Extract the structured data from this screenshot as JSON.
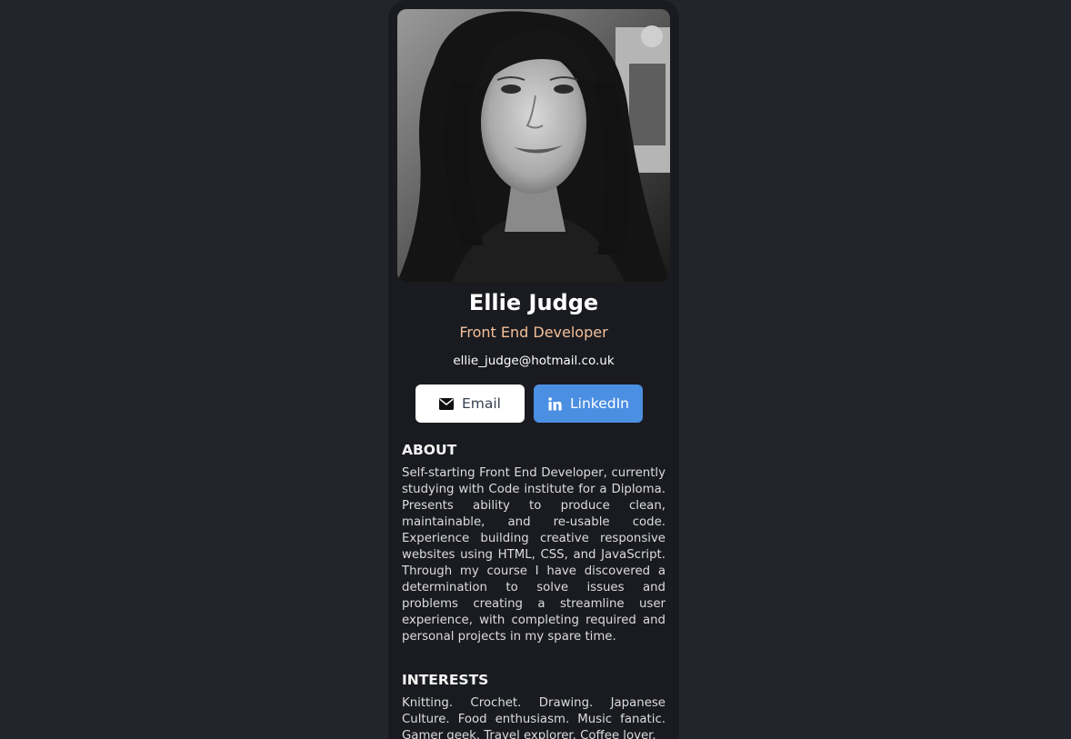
{
  "profile": {
    "name": "Ellie Judge",
    "role": "Front End Developer",
    "email": "ellie_judge@hotmail.co.uk",
    "photo_icon": "portrait-photo"
  },
  "buttons": {
    "email_label": "Email",
    "email_icon": "envelope-icon",
    "linkedin_label": "LinkedIn",
    "linkedin_icon": "linkedin-icon"
  },
  "about": {
    "title": "ABOUT",
    "text": "Self-starting Front End Developer, currently studying with Code institute for a Diploma. Presents ability to produce clean, maintainable, and re-usable code. Experience building creative responsive websites using HTML, CSS, and JavaScript. Through my course I have discovered a determination to solve issues and problems creating a streamline user experience, with completing required and personal projects in my spare time."
  },
  "interests": {
    "title": "INTERESTS",
    "text": "Knitting. Crochet. Drawing. Japanese Culture. Food enthusiasm. Music fanatic. Gamer geek. Travel explorer. Coffee lover."
  },
  "colors": {
    "page_background": "#23252c",
    "card_background": "#1a1b20",
    "role_accent": "#f3bf99",
    "linkedin_button": "#4b8fe2",
    "email_button": "#ffffff"
  }
}
